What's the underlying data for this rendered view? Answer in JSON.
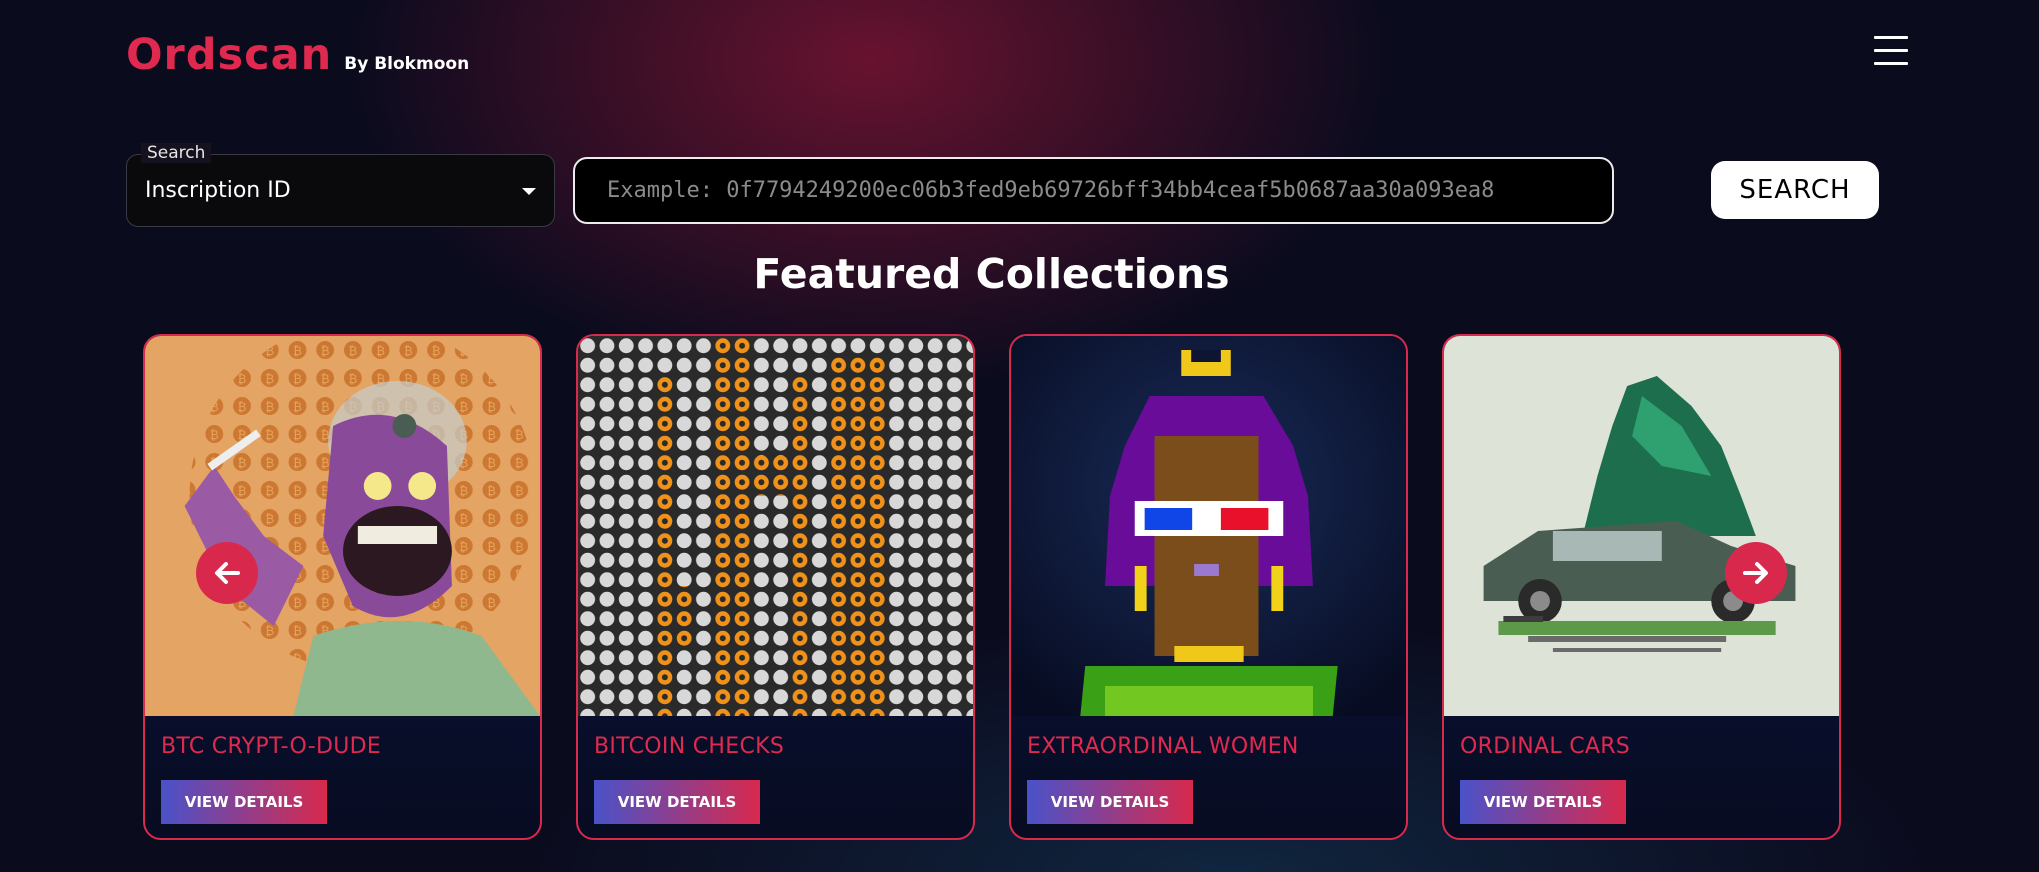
{
  "header": {
    "logo_main": "Ordscan",
    "logo_sub": "By Blokmoon",
    "menu_icon": "hamburger-menu-icon"
  },
  "search": {
    "type_label": "Search",
    "type_value": "Inscription ID",
    "placeholder": "Example: 0f7794249200ec06b3fed9eb69726bff34bb4ceaf5b0687aa30a093ea8",
    "button_label": "SEARCH"
  },
  "featured": {
    "title": "Featured Collections",
    "cards": [
      {
        "title": "BTC CRYPT-O-DUDE",
        "button_label": "VIEW DETAILS"
      },
      {
        "title": "BITCOIN CHECKS",
        "button_label": "VIEW DETAILS"
      },
      {
        "title": "EXTRAORDINAL WOMEN",
        "button_label": "VIEW DETAILS"
      },
      {
        "title": "ORDINAL CARS",
        "button_label": "VIEW DETAILS"
      }
    ],
    "prev_icon": "arrow-left-icon",
    "next_icon": "arrow-right-icon"
  },
  "colors": {
    "accent": "#e0294f",
    "background": "#0b0b1e",
    "button_gradient_start": "#4a52c9",
    "button_gradient_end": "#d8294d"
  }
}
